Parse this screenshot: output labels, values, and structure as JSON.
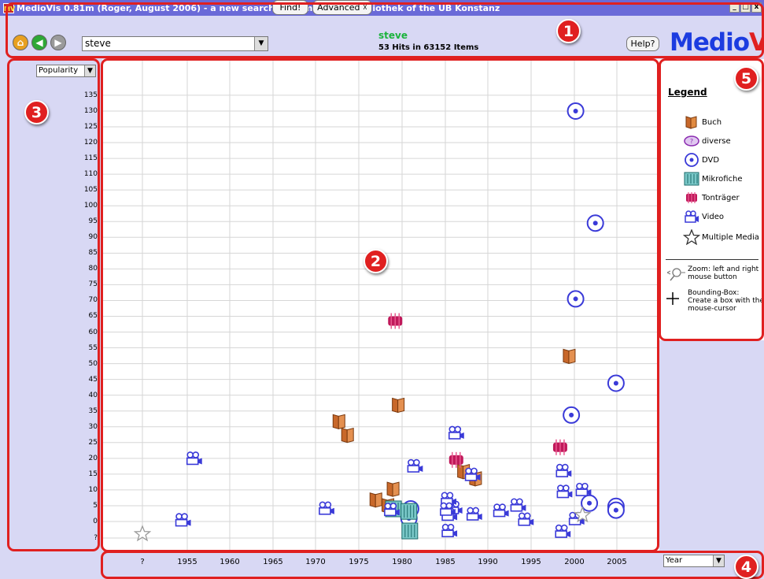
{
  "window": {
    "title": "MedioVis 0.81m (Roger, August 2006) - a new search system for the Mediothek of the UB Konstanz",
    "icon_text": "MV",
    "controls": [
      "_",
      "□",
      "x"
    ]
  },
  "toolbar": {
    "back_icon": "home-icon",
    "search_value": "steve",
    "find_label": "Find!",
    "advanced_label": "Advanced ☓",
    "query_word": "steve",
    "hits_text": "53 Hits in 63152 Items",
    "help_label": "Help?",
    "brand_a": "Medio",
    "brand_b": "Vis"
  },
  "badges": [
    "1",
    "2",
    "3",
    "4",
    "5"
  ],
  "y_axis": {
    "select_value": "Popularity",
    "tick_labels": [
      "135",
      "130",
      "125",
      "120",
      "115",
      "110",
      "105",
      "100",
      "95",
      "90",
      "85",
      "80",
      "75",
      "70",
      "65",
      "60",
      "55",
      "50",
      "45",
      "40",
      "35",
      "30",
      "25",
      "20",
      "15",
      "10",
      "5",
      "0",
      "?"
    ]
  },
  "x_axis": {
    "select_value": "Year",
    "tick_labels": [
      "?",
      "1955",
      "1960",
      "1965",
      "1970",
      "1975",
      "1980",
      "1985",
      "1990",
      "1995",
      "2000",
      "2005"
    ]
  },
  "legend": {
    "title": "Legend",
    "items": [
      {
        "label": "Buch",
        "icon": "book-icon"
      },
      {
        "label": "diverse",
        "icon": "diverse-icon"
      },
      {
        "label": "DVD",
        "icon": "dvd-icon"
      },
      {
        "label": "Mikrofiche",
        "icon": "microfiche-icon"
      },
      {
        "label": "Tonträger",
        "icon": "audio-icon"
      },
      {
        "label": "Video",
        "icon": "video-icon"
      },
      {
        "label": "Multiple Media",
        "icon": "star-icon"
      }
    ],
    "zoom_hint": "Zoom: left and right mouse button",
    "box_hint": "Bounding-Box: Create a box with the mouse-cursor"
  },
  "colors": {
    "book": "#c8682a",
    "dvd": "#3a3ad8",
    "microfiche": "#1a8a8a",
    "audio": "#c0185a",
    "video": "#3a3ad8",
    "star": "#9a9a9a",
    "frame": "#e02020"
  },
  "chart_data": {
    "type": "scatter",
    "xlabel": "Year",
    "ylabel": "Popularity",
    "x_categories": [
      "?",
      "1955",
      "1960",
      "1965",
      "1970",
      "1975",
      "1980",
      "1985",
      "1990",
      "1995",
      "2000",
      "2005"
    ],
    "ylim": [
      0,
      135
    ],
    "grid": true,
    "points": [
      {
        "x": 1999.5,
        "y": 52.3,
        "type": "Buch"
      },
      {
        "x": 1979.6,
        "y": 36.8,
        "type": "Buch"
      },
      {
        "x": 1972.7,
        "y": 31.6,
        "type": "Buch"
      },
      {
        "x": 1973.7,
        "y": 27.3,
        "type": "Buch"
      },
      {
        "x": 1987.2,
        "y": 15.8,
        "type": "Buch"
      },
      {
        "x": 1988.6,
        "y": 13.5,
        "type": "Buch"
      },
      {
        "x": 1979.0,
        "y": 10.2,
        "type": "Buch"
      },
      {
        "x": 1977.0,
        "y": 6.8,
        "type": "Buch"
      },
      {
        "x": 1978.4,
        "y": 5.0,
        "type": "Buch"
      },
      {
        "x": 2000.2,
        "y": 130.0,
        "type": "DVD"
      },
      {
        "x": 2002.5,
        "y": 94.5,
        "type": "DVD"
      },
      {
        "x": 2000.2,
        "y": 70.5,
        "type": "DVD"
      },
      {
        "x": 2004.9,
        "y": 43.8,
        "type": "DVD"
      },
      {
        "x": 1999.7,
        "y": 33.7,
        "type": "DVD"
      },
      {
        "x": 2001.8,
        "y": 5.8,
        "type": "DVD"
      },
      {
        "x": 2004.9,
        "y": 4.8,
        "type": "DVD"
      },
      {
        "x": 2004.9,
        "y": 3.6,
        "type": "DVD"
      },
      {
        "x": 1981.0,
        "y": 4.0,
        "type": "DVD"
      },
      {
        "x": 1980.8,
        "y": 1.0,
        "type": "DVD"
      },
      {
        "x": 1979.0,
        "y": 4.0,
        "type": "Mikrofiche"
      },
      {
        "x": 1980.8,
        "y": 3.2,
        "type": "Mikrofiche"
      },
      {
        "x": 1980.9,
        "y": -3.0,
        "type": "Mikrofiche"
      },
      {
        "x": 1979.2,
        "y": 63.5,
        "type": "Tonträger"
      },
      {
        "x": 1986.3,
        "y": 19.5,
        "type": "Tonträger"
      },
      {
        "x": 1998.4,
        "y": 23.5,
        "type": "Tonträger"
      },
      {
        "x": 1955.8,
        "y": 20.1,
        "type": "Video"
      },
      {
        "x": 1954.5,
        "y": 0.6,
        "type": "Video"
      },
      {
        "x": 1971.2,
        "y": 4.3,
        "type": "Video"
      },
      {
        "x": 1978.8,
        "y": 3.9,
        "type": "Video"
      },
      {
        "x": 1981.5,
        "y": 17.7,
        "type": "Video"
      },
      {
        "x": 1986.3,
        "y": 28.2,
        "type": "Video"
      },
      {
        "x": 1988.2,
        "y": 15.0,
        "type": "Video"
      },
      {
        "x": 1986.1,
        "y": 4.5,
        "type": "Video"
      },
      {
        "x": 1985.4,
        "y": 7.3,
        "type": "Video"
      },
      {
        "x": 1985.5,
        "y": 2.4,
        "type": "Video"
      },
      {
        "x": 1985.3,
        "y": 4.0,
        "type": "Video"
      },
      {
        "x": 1985.5,
        "y": -2.8,
        "type": "Video"
      },
      {
        "x": 1988.4,
        "y": 2.5,
        "type": "Video"
      },
      {
        "x": 1991.5,
        "y": 3.6,
        "type": "Video"
      },
      {
        "x": 1993.5,
        "y": 5.3,
        "type": "Video"
      },
      {
        "x": 1994.4,
        "y": 0.8,
        "type": "Video"
      },
      {
        "x": 1998.8,
        "y": 16.2,
        "type": "Video"
      },
      {
        "x": 1998.9,
        "y": 9.6,
        "type": "Video"
      },
      {
        "x": 2001.1,
        "y": 10.2,
        "type": "Video"
      },
      {
        "x": 2000.3,
        "y": 1.0,
        "type": "Video"
      },
      {
        "x": 1998.7,
        "y": -3.0,
        "type": "Video"
      },
      {
        "x": 1950.5,
        "y": -4.0,
        "type": "Multiple Media"
      },
      {
        "x": 2001.0,
        "y": 2.0,
        "type": "Multiple Media"
      }
    ]
  }
}
